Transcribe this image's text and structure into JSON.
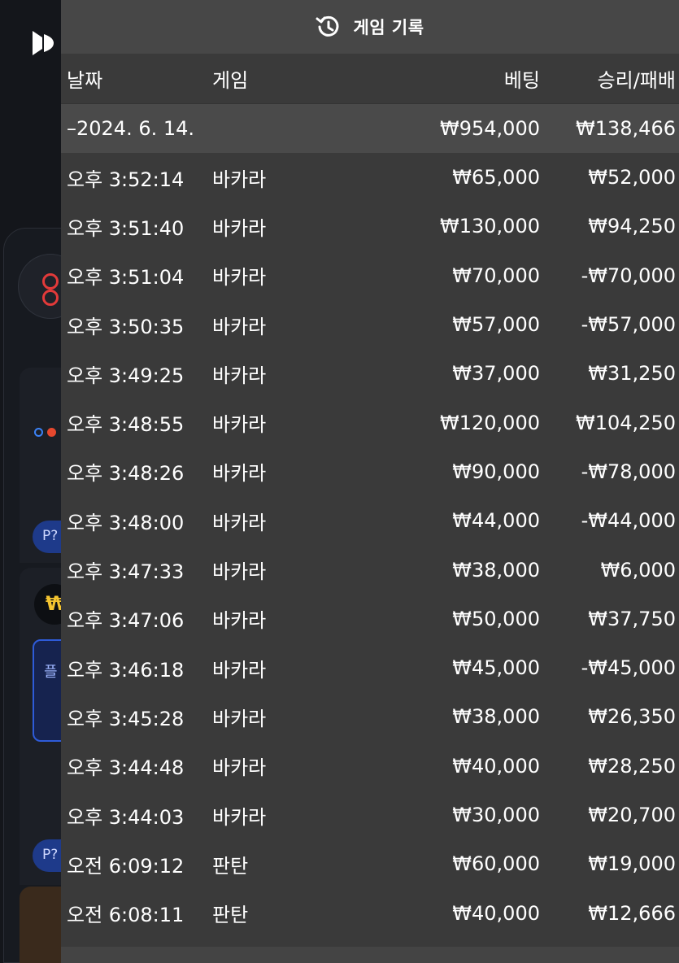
{
  "header": {
    "title": "게임 기록",
    "icon": "history-icon"
  },
  "columns": {
    "date": "날짜",
    "game": "게임",
    "bet": "베팅",
    "result": "승리/패배"
  },
  "group": {
    "date": "–2024. 6. 14.",
    "bet": "₩954,000",
    "result": "₩138,466"
  },
  "rows": [
    {
      "time": "오후 3:52:14",
      "game": "바카라",
      "bet": "₩65,000",
      "result": "₩52,000"
    },
    {
      "time": "오후 3:51:40",
      "game": "바카라",
      "bet": "₩130,000",
      "result": "₩94,250"
    },
    {
      "time": "오후 3:51:04",
      "game": "바카라",
      "bet": "₩70,000",
      "result": "-₩70,000"
    },
    {
      "time": "오후 3:50:35",
      "game": "바카라",
      "bet": "₩57,000",
      "result": "-₩57,000"
    },
    {
      "time": "오후 3:49:25",
      "game": "바카라",
      "bet": "₩37,000",
      "result": "₩31,250"
    },
    {
      "time": "오후 3:48:55",
      "game": "바카라",
      "bet": "₩120,000",
      "result": "₩104,250"
    },
    {
      "time": "오후 3:48:26",
      "game": "바카라",
      "bet": "₩90,000",
      "result": "-₩78,000"
    },
    {
      "time": "오후 3:48:00",
      "game": "바카라",
      "bet": "₩44,000",
      "result": "-₩44,000"
    },
    {
      "time": "오후 3:47:33",
      "game": "바카라",
      "bet": "₩38,000",
      "result": "₩6,000"
    },
    {
      "time": "오후 3:47:06",
      "game": "바카라",
      "bet": "₩50,000",
      "result": "₩37,750"
    },
    {
      "time": "오후 3:46:18",
      "game": "바카라",
      "bet": "₩45,000",
      "result": "-₩45,000"
    },
    {
      "time": "오후 3:45:28",
      "game": "바카라",
      "bet": "₩38,000",
      "result": "₩26,350"
    },
    {
      "time": "오후 3:44:48",
      "game": "바카라",
      "bet": "₩40,000",
      "result": "₩28,250"
    },
    {
      "time": "오후 3:44:03",
      "game": "바카라",
      "bet": "₩30,000",
      "result": "₩20,700"
    },
    {
      "time": "오전 6:09:12",
      "game": "판탄",
      "bet": "₩60,000",
      "result": "₩19,000"
    },
    {
      "time": "오전 6:08:11",
      "game": "판탄",
      "bet": "₩40,000",
      "result": "₩12,666"
    }
  ],
  "background": {
    "pill_label": "P?",
    "coin_symbol": "₩",
    "blue_card_label": "플"
  }
}
